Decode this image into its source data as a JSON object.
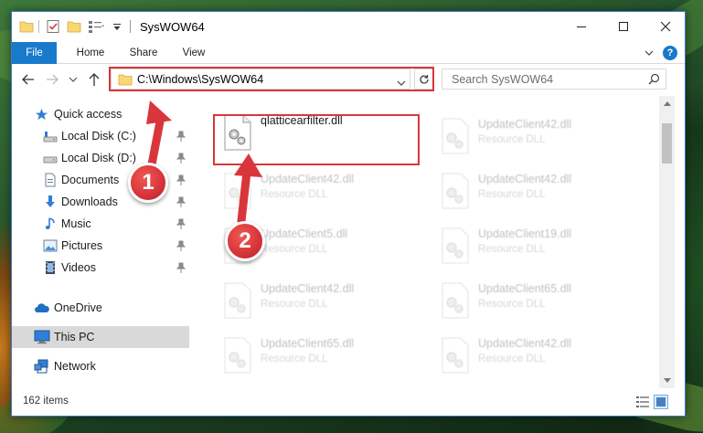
{
  "window": {
    "title": "SysWOW64",
    "minimize_glyph": "—",
    "maximize_glyph": "☐",
    "close_glyph": "✕"
  },
  "ribbon": {
    "tabs": [
      {
        "label": "File",
        "active": true
      },
      {
        "label": "Home"
      },
      {
        "label": "Share"
      },
      {
        "label": "View"
      }
    ],
    "help_label": "?"
  },
  "address": {
    "path": "C:\\Windows\\SysWOW64"
  },
  "search": {
    "placeholder": "Search SysWOW64"
  },
  "nav_pane": {
    "items": [
      {
        "label": "Quick access",
        "icon": "star-icon"
      },
      {
        "label": "Local Disk (C:)",
        "icon": "drive-icon",
        "pinned": true
      },
      {
        "label": "Local Disk (D:)",
        "icon": "drive-icon",
        "pinned": true
      },
      {
        "label": "Documents",
        "icon": "documents-icon",
        "pinned": true
      },
      {
        "label": "Downloads",
        "icon": "downloads-icon",
        "pinned": true
      },
      {
        "label": "Music",
        "icon": "music-icon",
        "pinned": true
      },
      {
        "label": "Pictures",
        "icon": "pictures-icon",
        "pinned": true
      },
      {
        "label": "Videos",
        "icon": "videos-icon",
        "pinned": true
      },
      {
        "label": "OneDrive",
        "icon": "onedrive-icon"
      },
      {
        "label": "This PC",
        "icon": "computer-icon",
        "selected": true
      },
      {
        "label": "Network",
        "icon": "network-icon"
      }
    ]
  },
  "files": [
    {
      "name": "qlatticearfilter.dll",
      "type": "",
      "highlighted": true
    },
    {
      "name": "UpdateClient42.dll",
      "type": "Resource DLL"
    },
    {
      "name": "UpdateClient42.dll",
      "type": "Resource DLL"
    },
    {
      "name": "UpdateClient42.dll",
      "type": "Resource DLL"
    },
    {
      "name": "UpdateClient5.dll",
      "type": "Resource DLL"
    },
    {
      "name": "UpdateClient19.dll",
      "type": "Resource DLL"
    },
    {
      "name": "UpdateClient42.dll",
      "type": "Resource DLL"
    },
    {
      "name": "UpdateClient65.dll",
      "type": "Resource DLL"
    },
    {
      "name": "UpdateClient65.dll",
      "type": "Resource DLL"
    },
    {
      "name": "UpdateClient42.dll",
      "type": "Resource DLL"
    }
  ],
  "status": {
    "item_count": "162 items"
  },
  "annotations": {
    "step1": "1",
    "step2": "2",
    "color": "#d9363c"
  }
}
